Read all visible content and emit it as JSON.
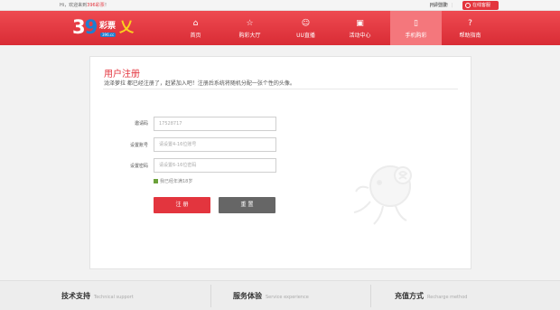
{
  "topbar": {
    "welcome_prefix": "Hi，欢迎来到",
    "site_name": "396彩票",
    "welcome_suffix": "！",
    "pipe": "|",
    "login_label": "请登录",
    "register_label": "用户注册",
    "service_label": "在线客服"
  },
  "logo": {
    "digit3": "3",
    "digit9": "9",
    "text": "彩票",
    "domain": "396.cc",
    "lucky": "乂"
  },
  "nav": [
    {
      "label": "首页",
      "icon": "home-icon",
      "glyph": "⌂"
    },
    {
      "label": "购彩大厅",
      "icon": "star-icon",
      "glyph": "☆"
    },
    {
      "label": "UU直播",
      "icon": "cat-icon",
      "glyph": "☺"
    },
    {
      "label": "活动中心",
      "icon": "gift-icon",
      "glyph": "▣"
    },
    {
      "label": "手机购彩",
      "icon": "phone-icon",
      "glyph": "▯"
    },
    {
      "label": "帮助指南",
      "icon": "help-icon",
      "glyph": "?"
    }
  ],
  "page": {
    "title": "用户注册",
    "subtitle": "泷泽萝拉 都已经注册了，赶紧加入吧！注册后系统将随机分配一张个性的头像。"
  },
  "form": {
    "invite_label": "邀请码",
    "invite_value": "17528717",
    "account_label": "设置账号",
    "account_placeholder": "请设置4-16位账号",
    "password_label": "设置密码",
    "password_placeholder": "请设置6-16位密码",
    "age_check_label": "我已经年满18岁",
    "submit_label": "注 册",
    "reset_label": "重 置"
  },
  "footer": [
    {
      "title": "技术支持",
      "en": "Technical support"
    },
    {
      "title": "服务体验",
      "en": "Service experience"
    },
    {
      "title": "充值方式",
      "en": "Recharge method"
    }
  ],
  "colors": {
    "brand_red": "#e3353e",
    "nav_active": "#f4777c",
    "logo_blue": "#1e7fd0"
  }
}
